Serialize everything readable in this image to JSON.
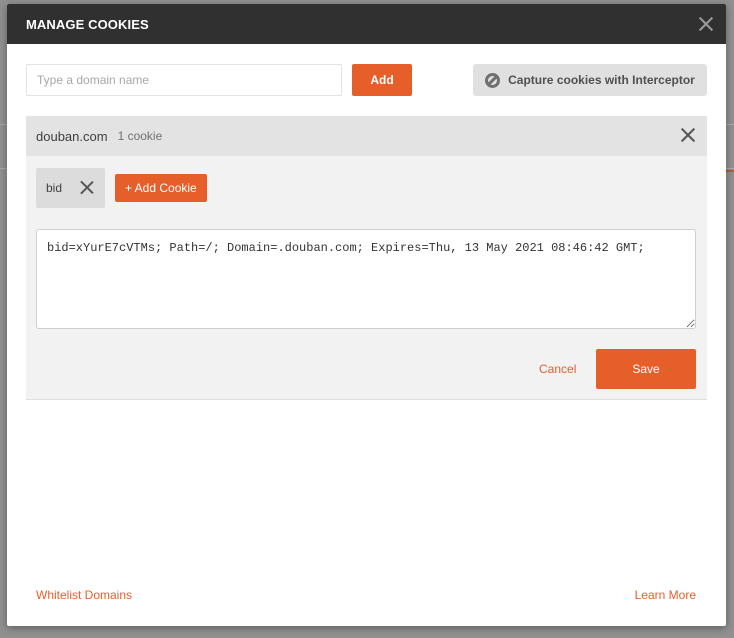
{
  "modal": {
    "title": "MANAGE COOKIES"
  },
  "toolbar": {
    "domain_placeholder": "Type a domain name",
    "domain_value": "",
    "add_label": "Add",
    "interceptor_label": "Capture cookies with Interceptor",
    "interceptor_icon": "interceptor-icon"
  },
  "domains": [
    {
      "name": "douban.com",
      "count_label": "1 cookie",
      "cookies": [
        {
          "name": "bid"
        }
      ],
      "add_cookie_label": "+ Add Cookie",
      "editor_value": "bid=xYurE7cVTMs; Path=/; Domain=.douban.com; Expires=Thu, 13 May 2021 08:46:42 GMT;",
      "cancel_label": "Cancel",
      "save_label": "Save"
    }
  ],
  "footer": {
    "whitelist_label": "Whitelist Domains",
    "learn_more_label": "Learn More"
  },
  "colors": {
    "accent": "#e65f2b",
    "header_bg": "#303030",
    "overlay": "#909090"
  }
}
